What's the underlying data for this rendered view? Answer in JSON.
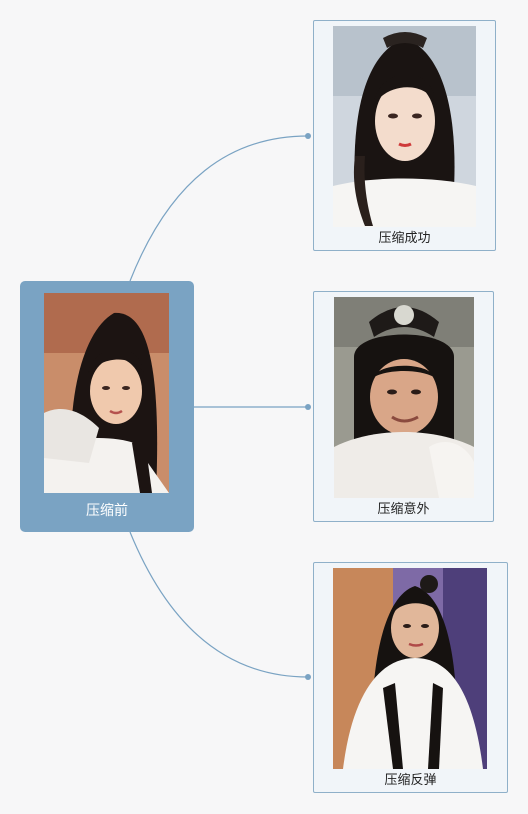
{
  "root": {
    "label": "压缩前",
    "image_icon": "portrait-long-black-hair-white-robe"
  },
  "branches": [
    {
      "label": "压缩成功",
      "image_icon": "portrait-braided-hair-white-robe"
    },
    {
      "label": "压缩意外",
      "image_icon": "portrait-man-topknot-costume"
    },
    {
      "label": "压缩反弹",
      "image_icon": "portrait-woman-stage-white-robe"
    }
  ],
  "colors": {
    "background": "#f7f7f8",
    "root_fill": "#7aa3c3",
    "node_fill": "#f1f5f9",
    "node_border": "#8fb0c9",
    "connector": "#7aa3c3"
  }
}
